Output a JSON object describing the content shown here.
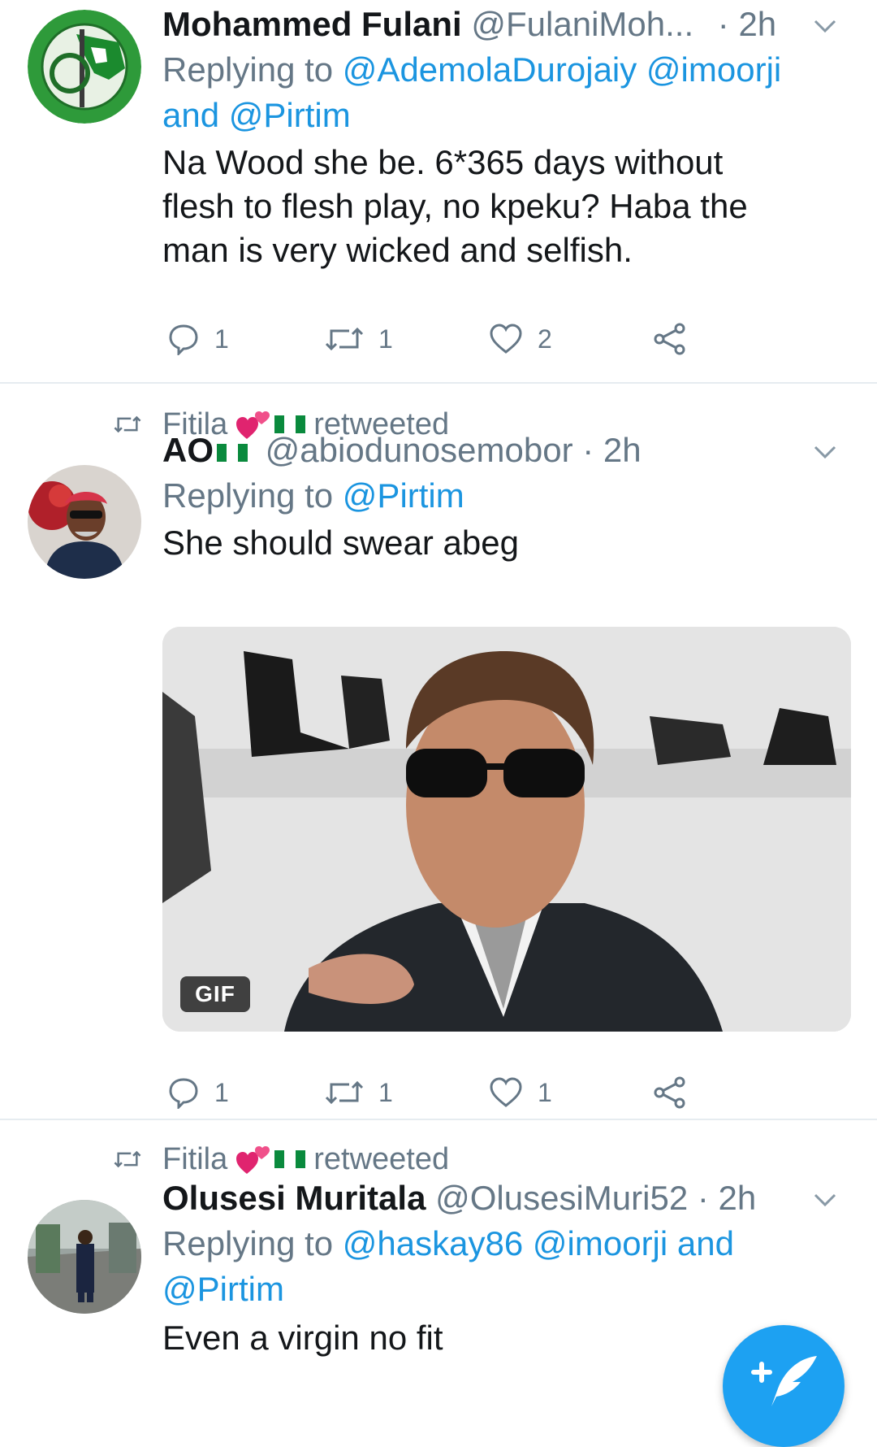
{
  "tweets": [
    {
      "author": {
        "name": "Mohammed Fulani",
        "handle": "@FulaniMoh...",
        "flag": false
      },
      "time": "· 2h",
      "reply_prefix": "Replying to",
      "reply_line1": "@AdemolaDurojaiy @imoorji",
      "reply_line2": "and @Pirtim",
      "text_lines": [
        "Na Wood she be. 6*365 days without",
        "flesh to flesh play, no kpeku? Haba the",
        "man is very wicked and selfish."
      ],
      "counts": {
        "reply": "1",
        "retweet": "1",
        "like": "2"
      }
    },
    {
      "retweeted_by": {
        "name": "Fitila",
        "suffix": "retweeted"
      },
      "author": {
        "name": "AO",
        "handle": "@abiodunosemobor",
        "flag": true
      },
      "time": "· 2h",
      "reply_prefix": "Replying to",
      "reply_line1": "@Pirtim",
      "text_lines": [
        "She should swear abeg"
      ],
      "media": {
        "badge": "GIF"
      },
      "counts": {
        "reply": "1",
        "retweet": "1",
        "like": "1"
      }
    },
    {
      "retweeted_by": {
        "name": "Fitila",
        "suffix": "retweeted"
      },
      "author": {
        "name": "Olusesi Muritala",
        "handle": "@OlusesiMuri52",
        "flag": false
      },
      "time": "· 2h",
      "reply_prefix": "Replying to",
      "reply_line1": "@haskay86 @imoorji and",
      "reply_line2": "@Pirtim",
      "text_lines": [
        "Even a virgin no fit"
      ]
    }
  ],
  "colors": {
    "accent": "#1b95e0",
    "meta": "#657786",
    "divider": "#e6ecf0",
    "fab": "#1da1f2"
  },
  "icons": {
    "reply": "reply-icon",
    "retweet": "retweet-icon",
    "like": "like-icon",
    "share": "share-icon",
    "compose": "compose-tweet-icon"
  }
}
